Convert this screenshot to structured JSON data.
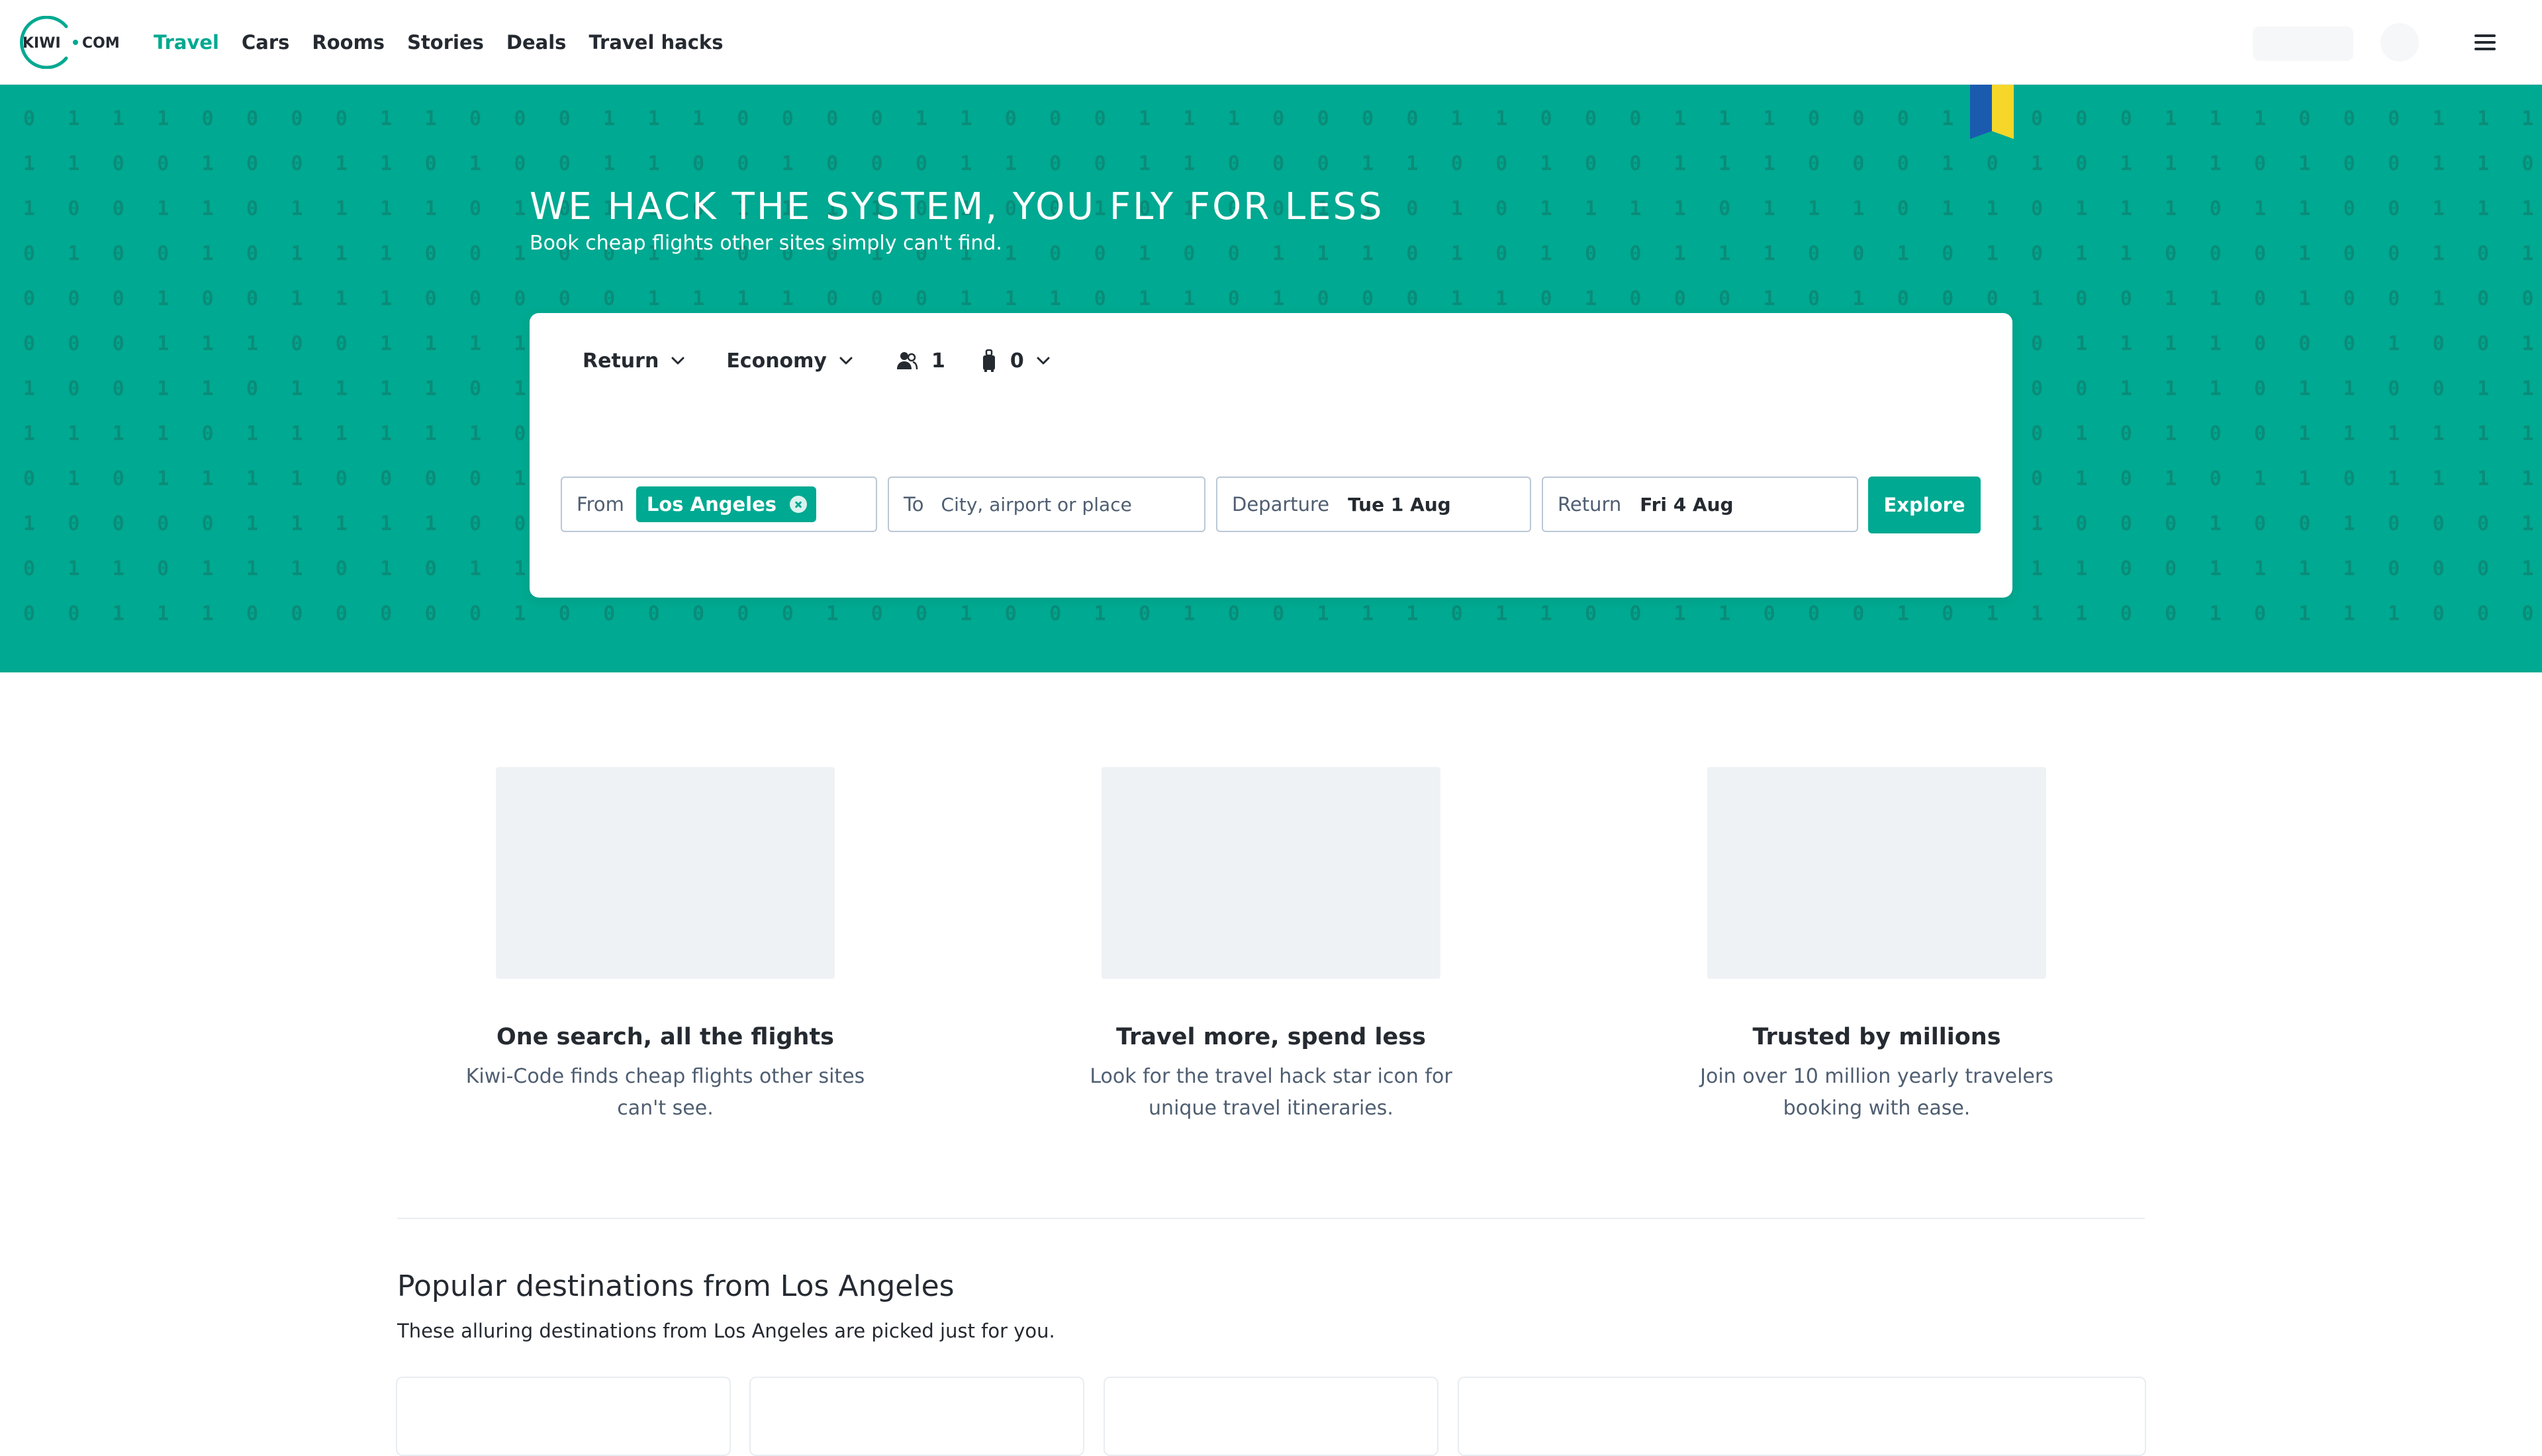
{
  "brand": {
    "name": "KIWI · COM",
    "logo_left": "KIWI",
    "logo_right": "COM",
    "accent": "#00a991"
  },
  "nav": {
    "items": [
      {
        "label": "Travel",
        "active": true
      },
      {
        "label": "Cars",
        "active": false
      },
      {
        "label": "Rooms",
        "active": false
      },
      {
        "label": "Stories",
        "active": false
      },
      {
        "label": "Deals",
        "active": false
      },
      {
        "label": "Travel hacks",
        "active": false
      }
    ]
  },
  "hero": {
    "title": "WE HACK THE SYSTEM, YOU FLY FOR LESS",
    "subtitle": "Book cheap flights other sites simply can't find.",
    "binary_rows": [
      "0 1 1 1 0 0 0 0 1 1 0 0 0 1 1 1 0 0 0 0 1 1 0 0 0 1 1 1 0 0 0 0 1 1 0 0 0 1 1 1 0 0 0 1 1 0 0 0 1 1 1 0 0 0 1 1 1 0 0 0",
      "1 1 0 0 1 0 0 1 1 0 1 0 0 1 1 0 0 1 0 0 0 1 1 0 0 1 1 0 0 0 1 1 0 0 1 0 0 1 1 1 0 0 0 1 0 1 0 1 1 1 0 1 0 0 1 1 0 1 0 1",
      "1 0 0 1 1 0 1 1 1 1 0 1 0 1 1 0 1 1 1 1 0 1 0 0 1 0 1 0 0 1 1 0 1 0 1 1 1 1 0 1 1 1 0 1 1 0 1 1 1 0 1 1 0 0 1 1 1 0 1 1",
      "0 1 0 0 1 0 1 1 1 0 0 1 0 0 1 1 0 0 0 1 0 1 1 0 0 1 0 0 1 1 1 0 1 0 1 0 0 1 1 1 0 0 1 0 1 0 1 1 0 0 0 1 0 0 1 0 1 1 0 1",
      "0 0 0 1 0 0 1 1 1 0 0 0 0 0 1 1 1 1 0 0 0 1 1 1 0 1 1 0 1 0 0 0 1 1 0 1 0 0 0 1 0 1 0 0 0 1 0 0 1 1 0 1 0 0 1 0 0 0 0 1",
      "0 0 0 1 1 1 0 0 1 1 1 1 0 0 0 1 0 1 1 0 0 0 1 0 1 0 1 1 0 0 1 0 1 0 1 1 0 0 0 1 0 1 0 1 1 0 1 1 1 1 0 0 0 1 0 0 1 0 1 1",
      "1 0 0 1 1 0 1 1 1 1 0 1 0 0 0 1 0 0 0 1 0 0 1 1 0 0 1 0 0 0 0 1 0 0 1 1 0 1 1 0 1 1 1 1 0 0 0 1 1 1 0 1 1 0 0 1 1 0 1 1",
      "1 1 1 1 0 1 1 1 1 1 1 0 0 1 0 1 0 0 1 0 1 0 0 1 1 0 1 0 1 0 1 0 0 0 1 1 0 1 0 0 1 1 0 1 0 0 1 0 1 0 0 1 1 1 1 1 1 0 1 0",
      "0 1 0 1 1 1 1 0 0 0 0 1 0 1 1 1 1 1 1 0 0 0 0 0 1 1 1 0 1 1 1 0 0 0 0 1 0 1 0 1 1 1 1 0 0 0 1 0 1 0 1 1 0 1 1 1 1 1 1 0",
      "1 0 0 0 0 1 1 1 1 1 0 0 1 0 0 1 0 0 0 1 1 1 1 0 1 0 0 0 1 1 1 0 0 0 1 0 0 0 1 1 1 1 1 0 0 1 0 0 0 1 0 0 1 0 0 0 1 1 0 1",
      "0 1 1 0 1 1 1 0 1 0 1 1 1 1 0 0 0 1 0 1 1 0 1 0 0 0 1 1 1 0 1 1 1 0 1 0 1 0 0 0 1 0 0 0 1 1 1 0 0 1 1 1 1 0 0 0 1 1 0 0",
      "0 0 1 1 1 0 0 0 0 0 0 1 0 0 0 0 0 0 1 0 0 1 0 0 1 0 1 0 0 1 1 1 0 1 1 0 0 1 1 0 0 0 1 0 1 1 1 0 0 1 0 1 1 1 0 0 0 0 0 1"
    ]
  },
  "search": {
    "trip_type": "Return",
    "cabin": "Economy",
    "passengers": "1",
    "bags": "0",
    "from_label": "From",
    "from_value": "Los Angeles",
    "to_label": "To",
    "to_placeholder": "City, airport or place",
    "departure_label": "Departure",
    "departure_value": "Tue 1 Aug",
    "return_label": "Return",
    "return_value": "Fri 4 Aug",
    "explore_label": "Explore"
  },
  "features": [
    {
      "title": "One search, all the flights",
      "text": "Kiwi-Code finds cheap flights other sites can't see."
    },
    {
      "title": "Travel more, spend less",
      "text": "Look for the travel hack star icon for unique travel itineraries."
    },
    {
      "title": "Trusted by millions",
      "text": "Join over 10 million yearly travelers booking with ease."
    }
  ],
  "popular": {
    "title": "Popular destinations from Los Angeles",
    "subtitle": "These alluring destinations from Los Angeles are picked just for you."
  },
  "colors": {
    "hero_bg": "#00a991",
    "binary_text": "#0a8c79",
    "ukraine_blue": "#1a5bb0",
    "ukraine_yellow": "#f5d629"
  }
}
